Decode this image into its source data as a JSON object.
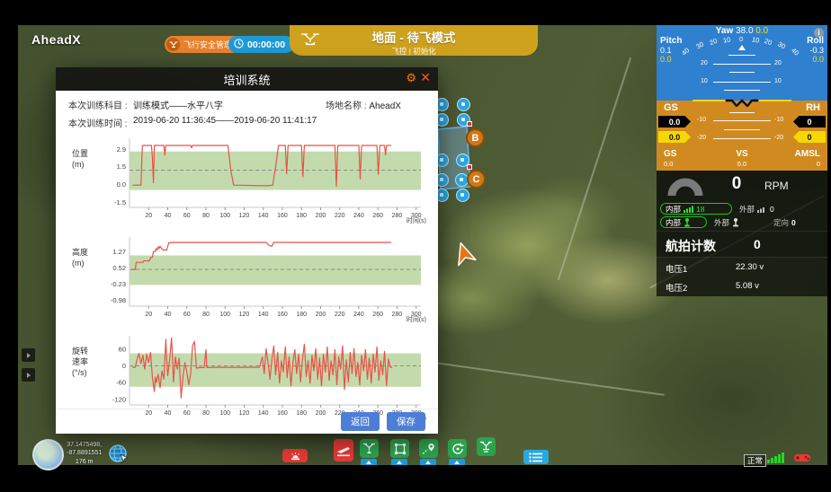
{
  "app": {
    "logo": "AheadX"
  },
  "topbar": {
    "safety_button": "飞行安全管理",
    "timer": "00:00:00",
    "mode_title": "地面 - 待飞模式",
    "mode_subtitle": "飞控 | 初始化"
  },
  "modal": {
    "title": "培训系统",
    "subject_label": "本次训练科目 :",
    "subject_value": "训练模式——水平八字",
    "site_label": "场地名称 :",
    "site_value": "AheadX",
    "time_label": "本次训练时间 :",
    "time_value": "2019-06-20 11:36:45——2019-06-20 11:41:17",
    "buttons": {
      "back": "返回",
      "save": "保存"
    }
  },
  "chart_data": [
    {
      "type": "line",
      "ylabel_lines": [
        "位置",
        "(m)"
      ],
      "xlabel": "时间(s)",
      "yticks": [
        "2.9",
        "1.5",
        "0.0",
        "-1.5"
      ],
      "ylim": [
        -1.9,
        3.85
      ],
      "xticks": [
        20,
        40,
        60,
        80,
        100,
        120,
        140,
        160,
        180,
        200,
        220,
        240,
        260,
        280,
        300
      ],
      "xlim": [
        0,
        305
      ],
      "band": [
        -0.45,
        2.75
      ],
      "dashed": 1.2,
      "grid": false,
      "legend": "none",
      "series": [
        [
          3,
          -0.05
        ],
        [
          12,
          -0.05
        ],
        [
          13.5,
          3.25
        ],
        [
          23,
          3.25
        ],
        [
          24,
          2.2
        ],
        [
          25,
          0.15
        ],
        [
          26,
          3.25
        ],
        [
          36,
          3.25
        ],
        [
          37,
          2.45
        ],
        [
          38,
          3.25
        ],
        [
          64,
          3.25
        ],
        [
          65,
          3.05
        ],
        [
          66,
          3.25
        ],
        [
          103,
          3.25
        ],
        [
          106,
          1.2
        ],
        [
          109,
          -0.05
        ],
        [
          145,
          -0.1
        ],
        [
          150,
          -0.05
        ],
        [
          153,
          1.5
        ],
        [
          156,
          3.25
        ],
        [
          163,
          3.25
        ],
        [
          164.5,
          0.9
        ],
        [
          166,
          3.25
        ],
        [
          180,
          3.25
        ],
        [
          181.5,
          0.65
        ],
        [
          183,
          3.25
        ],
        [
          215,
          3.25
        ],
        [
          216.5,
          -0.15
        ],
        [
          218,
          3.25
        ],
        [
          240,
          3.25
        ],
        [
          241.5,
          0.45
        ],
        [
          243,
          3.25
        ],
        [
          259,
          3.25
        ],
        [
          260.5,
          0.85
        ],
        [
          262,
          3.25
        ],
        [
          267,
          3.25
        ],
        [
          268,
          2.45
        ],
        [
          269,
          3.25
        ],
        [
          274,
          3.25
        ]
      ]
    },
    {
      "type": "line",
      "ylabel_lines": [
        "高度",
        "(m)"
      ],
      "xlabel": "时间(s)",
      "yticks": [
        "1.27",
        "0.52",
        "-0.23",
        "-0.98"
      ],
      "ylim": [
        -1.25,
        1.95
      ],
      "xticks": [
        20,
        40,
        60,
        80,
        100,
        120,
        140,
        160,
        180,
        200,
        220,
        240,
        260,
        280,
        300
      ],
      "xlim": [
        0,
        305
      ],
      "band": [
        -0.27,
        1.1
      ],
      "dashed": 0.45,
      "grid": false,
      "legend": "none",
      "series": [
        [
          2,
          0.45
        ],
        [
          6,
          0.45
        ],
        [
          7,
          0.78
        ],
        [
          14,
          0.78
        ],
        [
          15,
          0.85
        ],
        [
          21,
          0.85
        ],
        [
          22,
          1.0
        ],
        [
          24,
          1.02
        ],
        [
          25,
          1.28
        ],
        [
          27,
          1.28
        ],
        [
          28,
          1.42
        ],
        [
          29,
          1.35
        ],
        [
          30,
          1.5
        ],
        [
          31,
          1.42
        ],
        [
          32,
          1.52
        ],
        [
          33,
          1.45
        ],
        [
          35,
          1.35
        ],
        [
          39,
          1.35
        ],
        [
          41,
          1.68
        ],
        [
          44,
          1.7
        ],
        [
          143,
          1.7
        ],
        [
          146,
          1.56
        ],
        [
          149,
          1.52
        ],
        [
          151,
          1.7
        ],
        [
          274,
          1.7
        ]
      ]
    },
    {
      "type": "line",
      "ylabel_lines": [
        "旋转",
        "速率",
        "(°/s)"
      ],
      "xlabel": "时间(s)",
      "yticks": [
        "60",
        "0",
        "-60",
        "-120"
      ],
      "ylim": [
        -140,
        108
      ],
      "xticks": [
        20,
        40,
        60,
        80,
        100,
        120,
        140,
        160,
        180,
        200,
        220,
        240,
        260,
        280,
        300
      ],
      "xlim": [
        0,
        305
      ],
      "band": [
        -75,
        45
      ],
      "dashed": 0,
      "grid": false,
      "legend": "none",
      "series": [
        [
          3,
          -5
        ],
        [
          6,
          -5
        ],
        [
          8,
          25
        ],
        [
          10,
          45
        ],
        [
          12,
          8
        ],
        [
          14,
          38
        ],
        [
          16,
          -12
        ],
        [
          18,
          42
        ],
        [
          20,
          12
        ],
        [
          22,
          48
        ],
        [
          24,
          -42
        ],
        [
          26,
          -92
        ],
        [
          27,
          -40
        ],
        [
          28,
          -60
        ],
        [
          30,
          -30
        ],
        [
          32,
          -78
        ],
        [
          34,
          -18
        ],
        [
          36,
          -48
        ],
        [
          38,
          95
        ],
        [
          39,
          20
        ],
        [
          40,
          -35
        ],
        [
          42,
          22
        ],
        [
          44,
          100
        ],
        [
          45,
          30
        ],
        [
          46,
          -58
        ],
        [
          48,
          32
        ],
        [
          50,
          -12
        ],
        [
          52,
          28
        ],
        [
          54,
          -115
        ],
        [
          56,
          -38
        ],
        [
          58,
          12
        ],
        [
          60,
          -22
        ],
        [
          62,
          -68
        ],
        [
          64,
          -28
        ],
        [
          66,
          72
        ],
        [
          68,
          88
        ],
        [
          70,
          -8
        ],
        [
          74,
          -6
        ],
        [
          78,
          -6
        ],
        [
          80,
          58
        ],
        [
          81,
          -6
        ],
        [
          86,
          -5
        ],
        [
          120,
          -5
        ],
        [
          136,
          -5
        ],
        [
          139,
          32
        ],
        [
          141,
          -28
        ],
        [
          143,
          62
        ],
        [
          145,
          12
        ],
        [
          147,
          -48
        ],
        [
          149,
          22
        ],
        [
          151,
          72
        ],
        [
          153,
          -32
        ],
        [
          155,
          48
        ],
        [
          157,
          -62
        ],
        [
          159,
          18
        ],
        [
          161,
          -22
        ],
        [
          163,
          68
        ],
        [
          165,
          -42
        ],
        [
          167,
          32
        ],
        [
          169,
          -72
        ],
        [
          171,
          12
        ],
        [
          173,
          58
        ],
        [
          175,
          -28
        ],
        [
          177,
          42
        ],
        [
          179,
          -58
        ],
        [
          181,
          22
        ],
        [
          183,
          78
        ],
        [
          185,
          -38
        ],
        [
          187,
          18
        ],
        [
          189,
          -62
        ],
        [
          191,
          38
        ],
        [
          193,
          -18
        ],
        [
          195,
          62
        ],
        [
          197,
          -48
        ],
        [
          199,
          28
        ],
        [
          201,
          -72
        ],
        [
          203,
          42
        ],
        [
          205,
          -22
        ],
        [
          207,
          68
        ],
        [
          209,
          -52
        ],
        [
          211,
          18
        ],
        [
          213,
          -32
        ],
        [
          215,
          58
        ],
        [
          217,
          -68
        ],
        [
          219,
          32
        ],
        [
          221,
          -12
        ],
        [
          223,
          72
        ],
        [
          225,
          -85
        ],
        [
          227,
          22
        ],
        [
          229,
          -58
        ],
        [
          231,
          48
        ],
        [
          233,
          -28
        ],
        [
          235,
          62
        ],
        [
          237,
          -38
        ],
        [
          239,
          12
        ],
        [
          241,
          -68
        ],
        [
          243,
          38
        ],
        [
          245,
          -18
        ],
        [
          247,
          58
        ],
        [
          249,
          -48
        ],
        [
          251,
          28
        ],
        [
          253,
          -62
        ],
        [
          255,
          42
        ],
        [
          257,
          -22
        ],
        [
          259,
          68
        ],
        [
          261,
          -52
        ],
        [
          263,
          18
        ],
        [
          265,
          -32
        ],
        [
          267,
          52
        ],
        [
          269,
          -72
        ],
        [
          271,
          25
        ],
        [
          273,
          -5
        ],
        [
          275,
          -5
        ]
      ]
    }
  ],
  "instruments": {
    "yaw_label": "Yaw",
    "yaw_value": "38.0",
    "yaw_target": "0.0",
    "pitch_label": "Pitch",
    "pitch_value": "0.1",
    "pitch_target": "0.0",
    "roll_label": "Roll",
    "roll_value": "-0.3",
    "roll_target": "0.0",
    "info_icon": "i",
    "compass": [
      "40",
      "30",
      "20",
      "10",
      "0",
      "10",
      "20",
      "30",
      "40"
    ],
    "ladder": [
      "20",
      "10",
      "-10",
      "-20"
    ],
    "gs_label": "GS",
    "gs_black": "0.0",
    "gs_yellow": "0.0",
    "rh_label": "RH",
    "rh_black": "0",
    "rh_yellow": "0",
    "bottom": {
      "gs_label": "GS",
      "gs_value": "0.0",
      "vs_label": "VS",
      "vs_value": "0.0",
      "amsl_label": "AMSL",
      "amsl_value": "0"
    },
    "rpm": {
      "value": "0",
      "label": "RPM"
    },
    "links": {
      "inner1_label": "内部",
      "inner1_value": "18",
      "outer1_label": "外部",
      "outer1_value": "0",
      "inner2_label": "内部",
      "outer2_label": "外部",
      "heading_label": "定向",
      "heading_value": "0"
    },
    "photo_count_label": "航拍计数",
    "photo_count_value": "0",
    "voltage1_label": "电压1",
    "voltage1_value": "22.30 v",
    "voltage2_label": "电压2",
    "voltage2_value": "5.08 v"
  },
  "statusbar": {
    "status": "正常"
  },
  "coords": {
    "lat": "37.1475498,",
    "lon": "-87.8891551",
    "alt": "176 m"
  },
  "map_markers": {
    "b": "B",
    "c": "C"
  },
  "colors": {
    "accent_gold": "#cfa21d",
    "accent_blue": "#1f9ad6",
    "accent_orange": "#e8822b",
    "sky": "#2f80cf",
    "ground": "#d08a20",
    "band_green": "#bcd7a3",
    "line_red": "#e8524a"
  }
}
